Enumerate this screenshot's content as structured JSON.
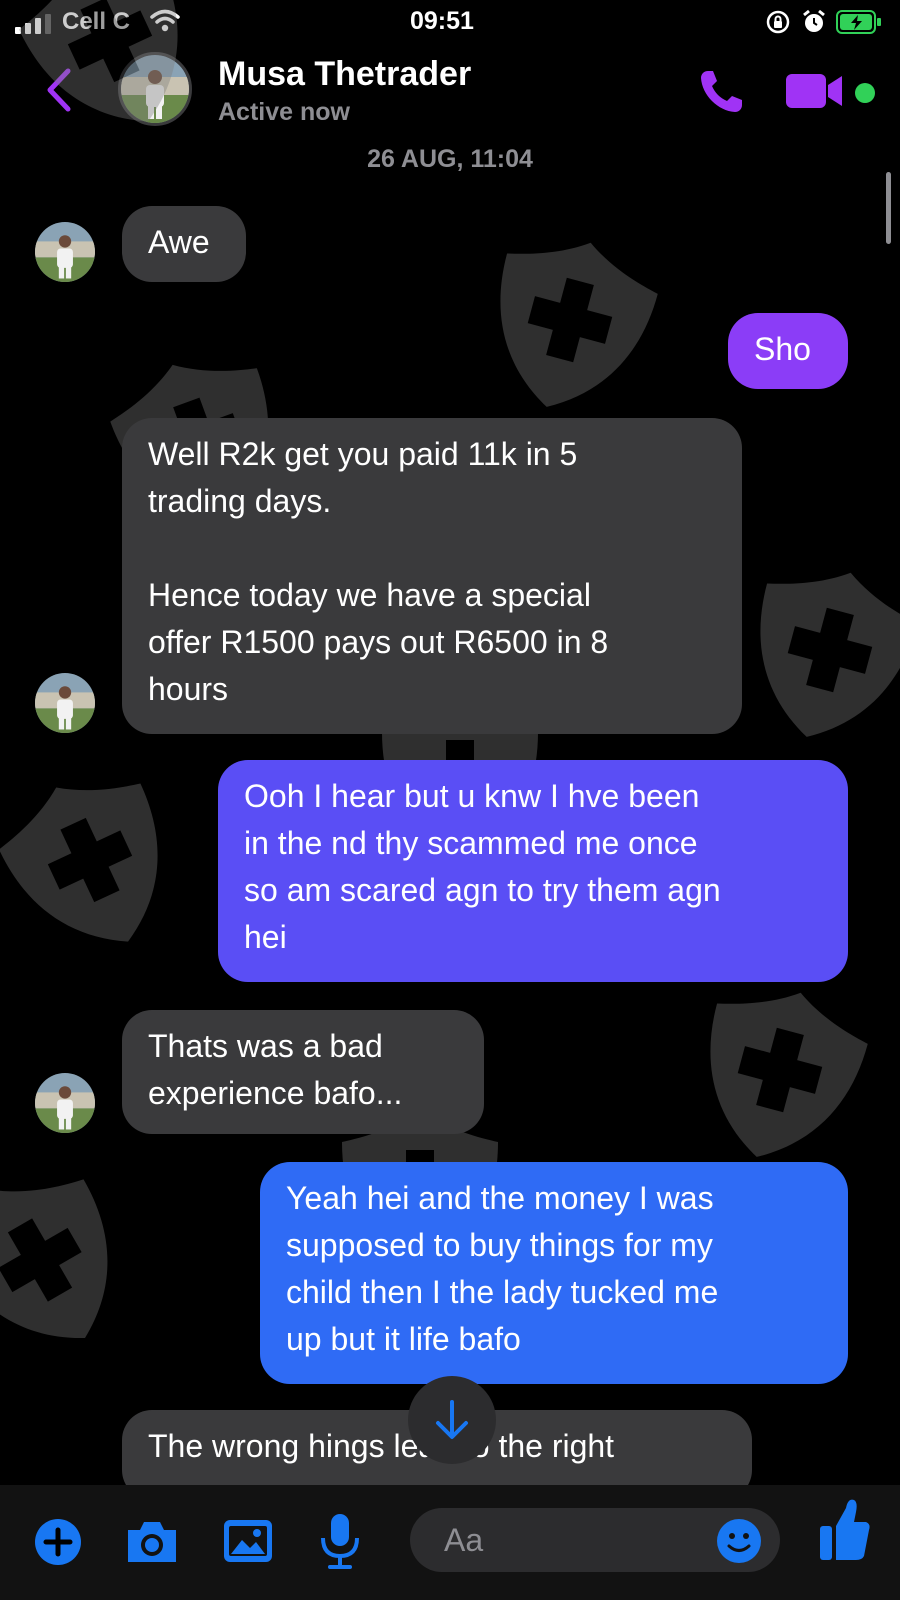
{
  "status_bar": {
    "carrier": "Cell C",
    "time": "09:51"
  },
  "header": {
    "contact_name": "Musa Thetrader",
    "presence": "Active now"
  },
  "conversation": {
    "timestamp": "26 AUG, 11:04",
    "messages": [
      {
        "direction": "incoming",
        "text": "Awe"
      },
      {
        "direction": "outgoing",
        "text": "Sho"
      },
      {
        "direction": "incoming",
        "text": "Well R2k get you paid 11k in 5\ntrading days.\n\nHence today we have a special\noffer R1500 pays out R6500 in 8\nhours"
      },
      {
        "direction": "outgoing",
        "text": "Ooh I hear but u knw I hve been\nin the nd thy scammed me once\nso am scared agn to try them agn\nhei"
      },
      {
        "direction": "incoming",
        "text": "Thats was a bad\nexperience bafo..."
      },
      {
        "direction": "outgoing",
        "text": "Yeah hei and the money I was\nsupposed to buy things for my\nchild then I the lady tucked me\nup but it life bafo"
      },
      {
        "direction": "incoming",
        "text": "The wrong hings lead to the right"
      }
    ]
  },
  "composer": {
    "placeholder": "Aa"
  },
  "colors": {
    "accent_purple": "#a033f5",
    "outgoing_purple": "#8b3df7",
    "outgoing_indigo": "#5a4ef5",
    "outgoing_blue": "#2f6bf5",
    "incoming_bubble": "#3a3a3c",
    "messenger_blue": "#1877f2",
    "online_green": "#31d158"
  },
  "icons": [
    "back-arrow-icon",
    "phone-icon",
    "video-camera-icon",
    "plus-icon",
    "camera-icon",
    "image-icon",
    "microphone-icon",
    "emoji-icon",
    "thumbs-up-icon",
    "arrow-down-icon",
    "shield-cross-watermark-icon"
  ]
}
